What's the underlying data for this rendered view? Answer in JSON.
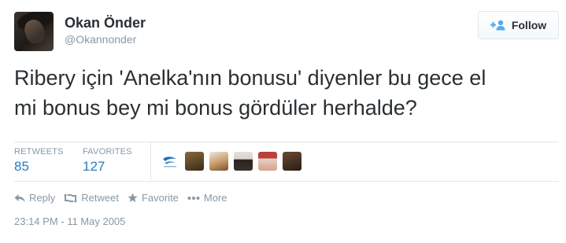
{
  "author": {
    "name": "Okan Önder",
    "handle": "@Okannonder"
  },
  "follow_button": {
    "label": "Follow",
    "icon": "follow-user-plus-icon"
  },
  "tweet": {
    "line1": "Ribery için 'Anelka'nın bonusu' diyenler bu gece el",
    "line2": "mi bonus bey mi bonus gördüler herhalde?"
  },
  "stats": {
    "retweets_label": "RETWEETS",
    "retweets_value": "85",
    "favorites_label": "FAVORITES",
    "favorites_value": "127"
  },
  "favoriters": [
    {
      "kind": "logo",
      "colors": [
        "#1f6fb5",
        "#ffffff"
      ]
    },
    {
      "kind": "face",
      "colors": [
        "#8a6a3c",
        "#3a2a1a"
      ]
    },
    {
      "kind": "face",
      "colors": [
        "#c79a6a",
        "#7a4f2c"
      ]
    },
    {
      "kind": "face",
      "colors": [
        "#d9d2c8",
        "#2a2320"
      ]
    },
    {
      "kind": "face",
      "colors": [
        "#b8413c",
        "#e8d2c4"
      ]
    },
    {
      "kind": "face",
      "colors": [
        "#6b4a32",
        "#2a1d14"
      ]
    }
  ],
  "actions": {
    "reply": "Reply",
    "retweet": "Retweet",
    "favorite": "Favorite",
    "more": "More"
  },
  "timestamp": "23:14 PM - 11 May 2005",
  "colors": {
    "link_blue": "#2b7bb9",
    "muted_gray": "#8899a6",
    "text": "#292f33",
    "follow_icon_blue": "#55acee"
  }
}
